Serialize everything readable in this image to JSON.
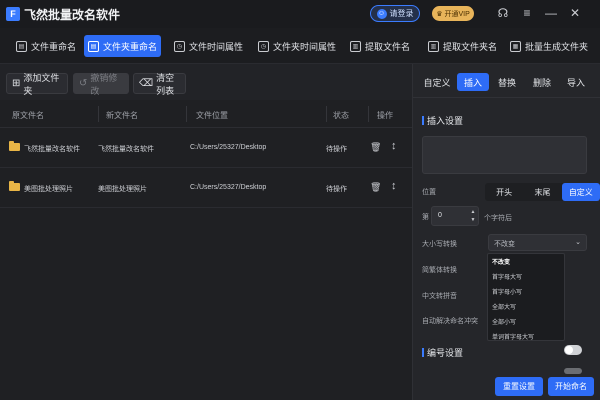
{
  "app": {
    "title": "飞然批量改名软件",
    "logo_char": "F"
  },
  "titlebar": {
    "login": "请登录",
    "vip": "开通VIP"
  },
  "mode_tabs": [
    {
      "label": "文件重命名",
      "active": false
    },
    {
      "label": "文件夹重命名",
      "active": true
    },
    {
      "label": "文件时间属性",
      "active": false
    },
    {
      "label": "文件夹时间属性",
      "active": false
    },
    {
      "label": "提取文件名",
      "active": false
    },
    {
      "label": "提取文件夹名",
      "active": false
    },
    {
      "label": "批量生成文件夹",
      "active": false
    }
  ],
  "toolbar": {
    "add": "添加文件夹",
    "undo": "撤销修改",
    "clear": "清空列表"
  },
  "table": {
    "headers": {
      "orig": "原文件名",
      "new": "新文件名",
      "loc": "文件位置",
      "status": "状态",
      "action": "操作"
    },
    "rows": [
      {
        "orig": "飞然批量改名软件",
        "new": "飞然批量改名软件",
        "loc": "C:/Users/25327/Desktop",
        "status": "待操作"
      },
      {
        "orig": "美图批处理照片",
        "new": "美图批处理照片",
        "loc": "C:/Users/25327/Desktop",
        "status": "待操作"
      }
    ]
  },
  "right_panel": {
    "tabs": [
      {
        "label": "自定义",
        "active": false
      },
      {
        "label": "插入",
        "active": true
      },
      {
        "label": "替换",
        "active": false
      },
      {
        "label": "删除",
        "active": false
      },
      {
        "label": "导入",
        "active": false
      }
    ],
    "insert_title": "插入设置",
    "position_label": "位置",
    "position_options": [
      {
        "label": "开头",
        "active": false
      },
      {
        "label": "末尾",
        "active": false
      },
      {
        "label": "自定义",
        "active": true
      }
    ],
    "index_prefix": "第",
    "index_value": "0",
    "index_suffix": "个字符后",
    "case_label": "大小写转换",
    "case_value": "不改变",
    "case_options": [
      "不改变",
      "首字母大写",
      "首字母小写",
      "全部大写",
      "全部小写",
      "单词首字母大写"
    ],
    "trad_label": "简繁体转换",
    "pinyin_label": "中文转拼音",
    "conflict_label": "自动解决命名冲突",
    "numbering_title": "编号设置",
    "reset": "重置设置",
    "start": "开始命名"
  }
}
